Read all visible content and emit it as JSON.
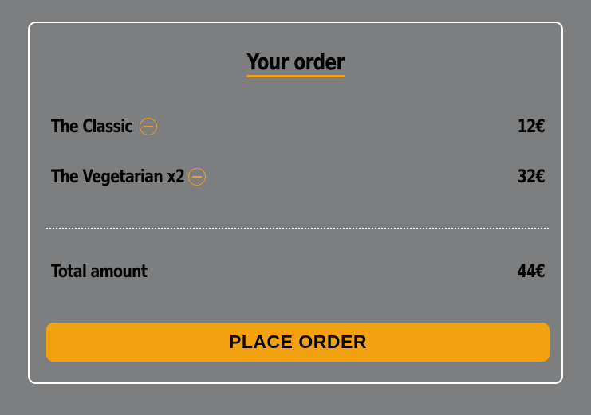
{
  "order": {
    "title": "Your order",
    "items": [
      {
        "name": "The Classic",
        "price": "12€"
      },
      {
        "name": "The Vegetarian x2",
        "price": "32€"
      }
    ],
    "total": {
      "label": "Total amount",
      "value": "44€"
    },
    "place_order_label": "PLACE ORDER"
  },
  "icons": {
    "remove": "minus-circle-icon"
  },
  "colors": {
    "background": "#7d7e80",
    "accent": "#f4a111",
    "text": "#000000",
    "border": "#ffffff"
  }
}
